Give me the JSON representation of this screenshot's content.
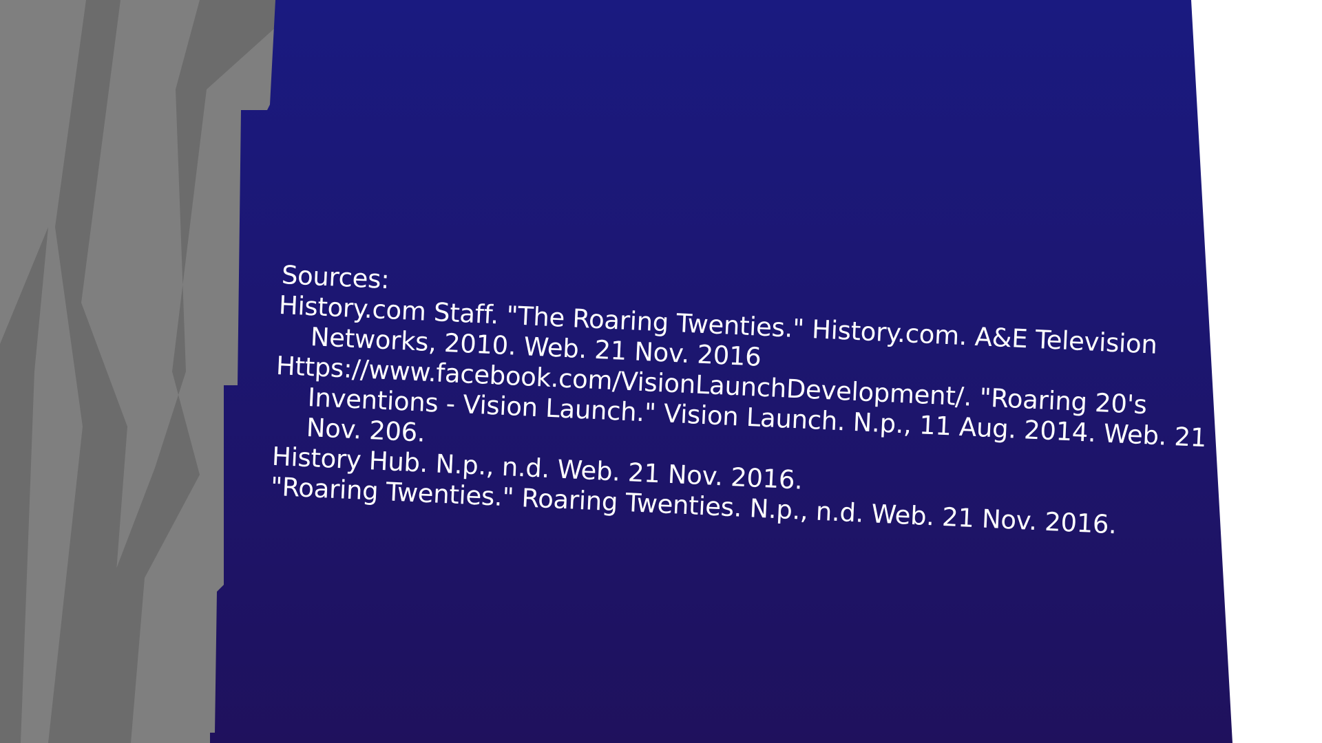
{
  "slide": {
    "background_color": "#1b1b7d",
    "side_color": "#7f7f7f",
    "side_dark_color": "#6c6c6c",
    "heading": "Sources:",
    "citations": [
      "History.com Staff. \"The Roaring Twenties.\" History.com. A&E Television Networks, 2010. Web. 21 Nov. 2016",
      "Https://www.facebook.com/VisionLaunchDevelopment/. \"Roaring 20's Inventions - Vision Launch.\" Vision Launch. N.p., 11 Aug. 2014. Web. 21 Nov. 206.",
      "History Hub. N.p., n.d. Web. 21 Nov. 2016.",
      "\"Roaring Twenties.\" Roaring Twenties. N.p., n.d. Web. 21 Nov. 2016."
    ]
  }
}
